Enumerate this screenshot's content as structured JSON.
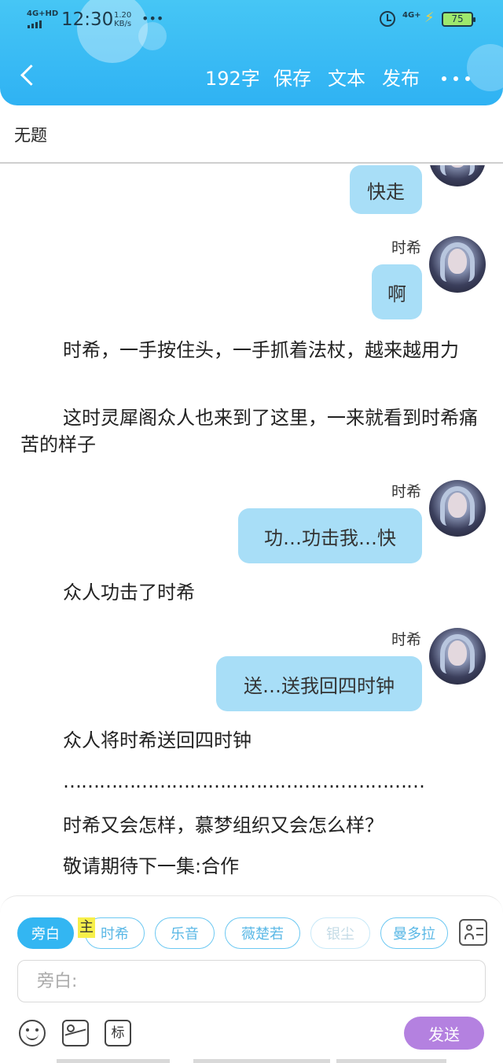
{
  "status_bar": {
    "network": "4G+HD",
    "time": "12:30",
    "speed_value": "1.20",
    "speed_unit": "KB/s",
    "dots": "•••",
    "network_right": "4G+",
    "battery": "75"
  },
  "header": {
    "word_count": "192字",
    "save_label": "保存",
    "text_label": "文本",
    "publish_label": "发布"
  },
  "title": "无题",
  "content": {
    "messages": [
      {
        "speaker": "",
        "text": "快走"
      },
      {
        "speaker": "时希",
        "text": "啊"
      },
      {
        "speaker": "时希",
        "text": "功…功击我…快"
      },
      {
        "speaker": "时希",
        "text": "送…送我回四时钟"
      }
    ],
    "narrations": [
      "时希，一手按住头，一手抓着法杖，越来越用力",
      "这时灵犀阁众人也来到了这里，一来就看到时希痛苦的样子",
      "众人功击了时希",
      "众人将时希送回四时钟",
      "……………………………………………………",
      "时希又会怎样，慕梦组织又会怎么样？",
      "敬请期待下一集:合作"
    ]
  },
  "characters": [
    {
      "label": "旁白",
      "state": "active"
    },
    {
      "label": "时希",
      "state": "normal",
      "badge": "主"
    },
    {
      "label": "乐音",
      "state": "normal"
    },
    {
      "label": "薇楚若",
      "state": "normal"
    },
    {
      "label": "银尘",
      "state": "faded"
    },
    {
      "label": "曼多拉",
      "state": "normal"
    }
  ],
  "input": {
    "placeholder": "旁白:"
  },
  "toolbar": {
    "tag_label": "标",
    "send_label": "发送"
  },
  "colors": {
    "header_blue": "#2fb2f3",
    "bubble_blue": "#a8def7",
    "send_purple": "#b481e0",
    "badge_yellow": "#f7ef4a"
  }
}
